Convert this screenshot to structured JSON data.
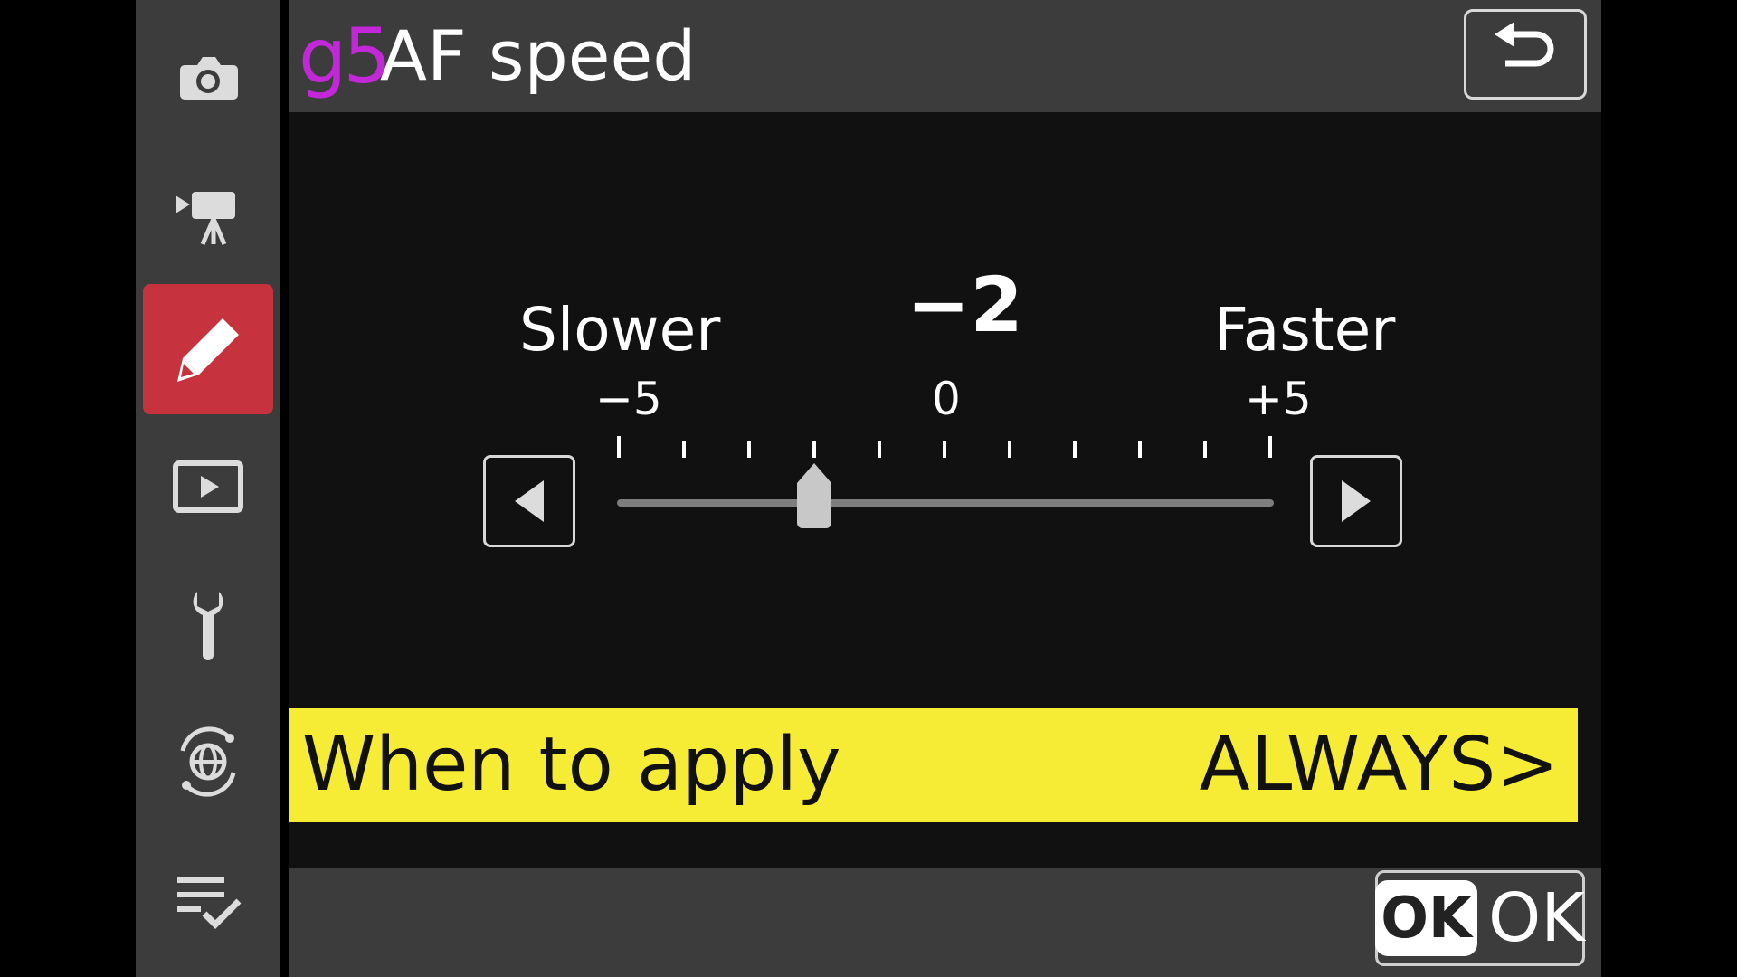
{
  "header": {
    "code": "g5",
    "title": "AF speed"
  },
  "sidebar": {
    "items": [
      {
        "icon": "camera-icon",
        "active": false
      },
      {
        "icon": "movie-camera-icon",
        "active": false
      },
      {
        "icon": "pencil-icon",
        "active": true
      },
      {
        "icon": "playback-icon",
        "active": false
      },
      {
        "icon": "wrench-icon",
        "active": false
      },
      {
        "icon": "network-icon",
        "active": false
      },
      {
        "icon": "my-menu-icon",
        "active": false
      }
    ],
    "active_color": "#c7323f"
  },
  "slider": {
    "left_label": "Slower",
    "right_label": "Faster",
    "current_value": "−2",
    "min_label": "−5",
    "mid_label": "0",
    "max_label": "+5",
    "min": -5,
    "max": 5,
    "value": -2
  },
  "apply_row": {
    "label": "When to apply",
    "value": "ALWAYS>",
    "highlight_color": "#f6ec36"
  },
  "footer": {
    "ok_badge": "OK",
    "ok_label": "OK"
  }
}
